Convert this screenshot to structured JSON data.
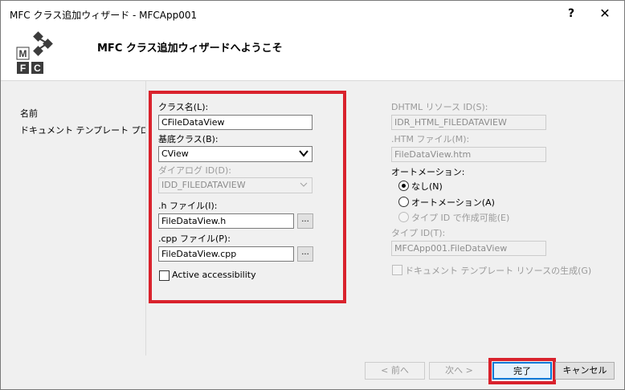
{
  "window": {
    "title": "MFC クラス追加ウィザード - MFCApp001",
    "help_glyph": "?",
    "close_glyph": "✕"
  },
  "header": {
    "title": "MFC クラス追加ウィザードへようこそ",
    "logo_letters": [
      "M",
      "F",
      "C"
    ]
  },
  "nav": {
    "items": [
      {
        "label": "名前"
      },
      {
        "label": "ドキュメント テンプレート プロパティ"
      }
    ]
  },
  "form": {
    "class_name_label": "クラス名(L):",
    "class_name_value": "CFileDataView",
    "base_class_label": "基底クラス(B):",
    "base_class_value": "CView",
    "dialog_id_label": "ダイアログ ID(D):",
    "dialog_id_value": "IDD_FILEDATAVIEW",
    "h_file_label": ".h ファイル(I):",
    "h_file_value": "FileDataView.h",
    "cpp_file_label": ".cpp ファイル(P):",
    "cpp_file_value": "FileDataView.cpp",
    "browse_label": "...",
    "accessibility_label": "Active accessibility",
    "dhtml_label": "DHTML リソース ID(S):",
    "dhtml_value": "IDR_HTML_FILEDATAVIEW",
    "htm_label": ".HTM ファイル(M):",
    "htm_value": "FileDataView.htm",
    "automation_label": "オートメーション:",
    "radio_none": "なし(N)",
    "radio_automation": "オートメーション(A)",
    "radio_typeid": "タイプ ID で作成可能(E)",
    "typeid_label": "タイプ ID(T):",
    "typeid_value": "MFCApp001.FileDataView",
    "doc_template_label": "ドキュメント テンプレート リソースの生成(G)"
  },
  "buttons": {
    "prev": "< 前へ",
    "next": "次へ >",
    "finish": "完了",
    "cancel": "キャンセル"
  },
  "colors": {
    "highlight_red": "#d9222c",
    "accent_blue": "#0078d7"
  }
}
